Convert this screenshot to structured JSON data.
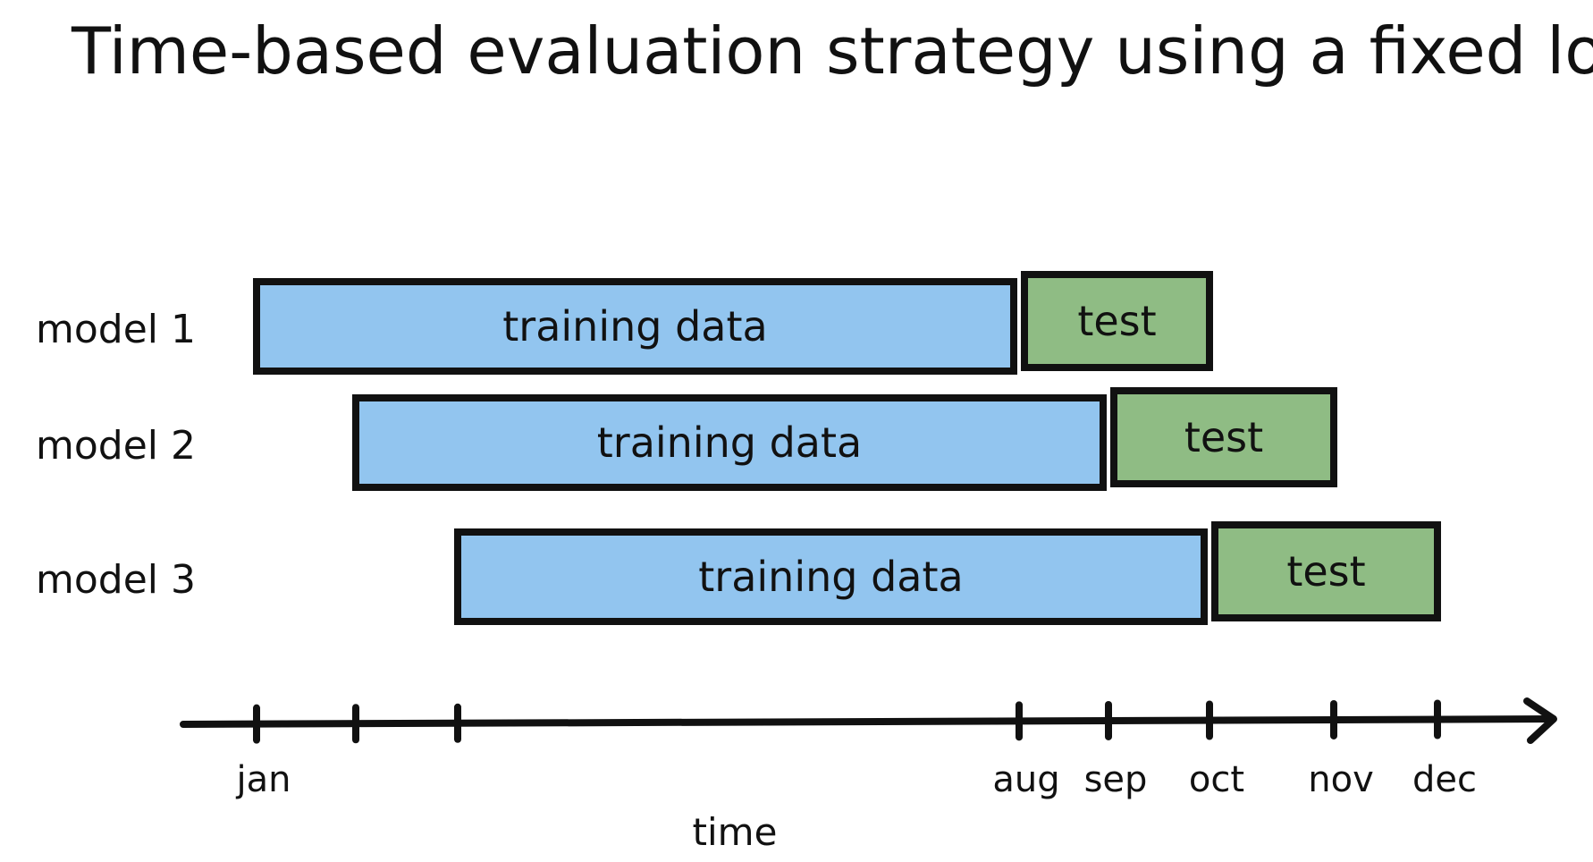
{
  "title": "Time-based evaluation strategy using a fixed lookback",
  "axis": {
    "label": "time",
    "ticks": [
      {
        "pos": 0,
        "label": "jan"
      },
      {
        "pos": 1,
        "label": ""
      },
      {
        "pos": 2,
        "label": ""
      },
      {
        "pos": 7,
        "label": "aug"
      },
      {
        "pos": 8,
        "label": "sep"
      },
      {
        "pos": 9,
        "label": "oct"
      },
      {
        "pos": 10,
        "label": "nov"
      },
      {
        "pos": 11,
        "label": "dec"
      }
    ]
  },
  "models": [
    {
      "label": "model 1",
      "train": {
        "start": 0,
        "end": 7,
        "label": "training data"
      },
      "test": {
        "start": 7,
        "end": 9,
        "label": "test"
      }
    },
    {
      "label": "model 2",
      "train": {
        "start": 1,
        "end": 8,
        "label": "training data"
      },
      "test": {
        "start": 8,
        "end": 10,
        "label": "test"
      }
    },
    {
      "label": "model 3",
      "train": {
        "start": 2,
        "end": 9,
        "label": "training data"
      },
      "test": {
        "start": 9,
        "end": 11,
        "label": "test"
      }
    }
  ],
  "colors": {
    "training": "#92c5ef",
    "test": "#8fbc84",
    "stroke": "#111111"
  }
}
